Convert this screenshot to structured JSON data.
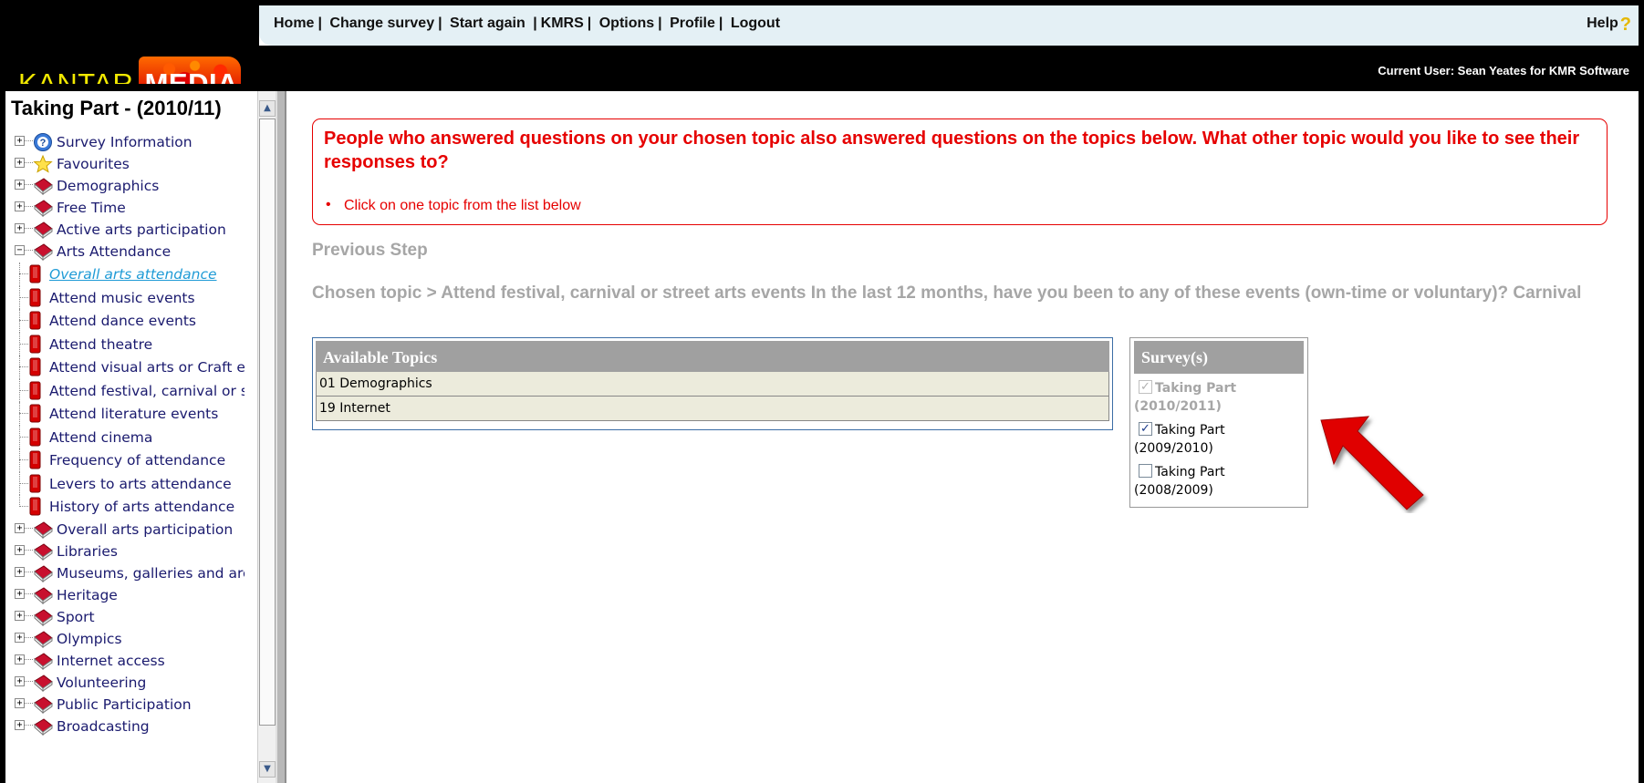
{
  "brand": {
    "word1": "KANTAR",
    "word2": "MEDIA",
    "accent": "#f2e900"
  },
  "nav": {
    "items": [
      "Home",
      "Change survey",
      "Start again",
      "KMRS",
      "Options",
      "Profile",
      "Logout"
    ],
    "help_label": "Help",
    "help_icon": "?"
  },
  "user": {
    "current_user": "Current User: Sean Yeates for KMR Software"
  },
  "sidebar": {
    "title": "Taking Part - (2010/11)",
    "nodes": [
      {
        "label": "Survey Information",
        "icon": "info-icon",
        "expanded": false
      },
      {
        "label": "Favourites",
        "icon": "star-icon",
        "expanded": false
      },
      {
        "label": "Demographics",
        "icon": "book-icon",
        "expanded": false
      },
      {
        "label": "Free Time",
        "icon": "book-icon",
        "expanded": false
      },
      {
        "label": "Active arts participation",
        "icon": "book-icon",
        "expanded": false
      },
      {
        "label": "Arts Attendance",
        "icon": "book-icon",
        "expanded": true
      }
    ],
    "children": [
      {
        "label": "Overall arts attendance",
        "selected": true
      },
      {
        "label": "Attend music events"
      },
      {
        "label": "Attend dance events"
      },
      {
        "label": "Attend theatre"
      },
      {
        "label": "Attend visual arts or Craft e"
      },
      {
        "label": "Attend festival, carnival or s"
      },
      {
        "label": "Attend literature events"
      },
      {
        "label": "Attend cinema"
      },
      {
        "label": "Frequency of attendance"
      },
      {
        "label": "Levers to arts attendance"
      },
      {
        "label": "History of arts attendance"
      }
    ],
    "nodes_after": [
      {
        "label": "Overall arts participation"
      },
      {
        "label": "Libraries"
      },
      {
        "label": "Museums, galleries and arc"
      },
      {
        "label": "Heritage"
      },
      {
        "label": "Sport"
      },
      {
        "label": "Olympics"
      },
      {
        "label": "Internet access"
      },
      {
        "label": "Volunteering"
      },
      {
        "label": "Public Participation"
      },
      {
        "label": "Broadcasting"
      }
    ]
  },
  "main": {
    "instruction": "People who answered questions on your chosen topic also answered questions on the topics below. What other topic would you like to see their responses to?",
    "bullet": "Click on one topic from the list below",
    "previous_step": "Previous Step",
    "chosen_topic": "Chosen topic > Attend festival, carnival or street arts events In the last 12 months, have you been to any of these events (own-time or voluntary)? Carnival",
    "topics": {
      "header": "Available Topics",
      "rows": [
        "01 Demographics",
        "19 Internet"
      ]
    },
    "surveys": {
      "header": "Survey(s)",
      "options": [
        {
          "line1": "Taking Part",
          "line2": "(2010/2011)",
          "checked": true,
          "disabled": true
        },
        {
          "line1": "Taking Part",
          "line2": "(2009/2010)",
          "checked": true,
          "disabled": false
        },
        {
          "line1": "Taking Part",
          "line2": "(2008/2009)",
          "checked": false,
          "disabled": false
        }
      ]
    },
    "arrow_color": "#e00000"
  }
}
